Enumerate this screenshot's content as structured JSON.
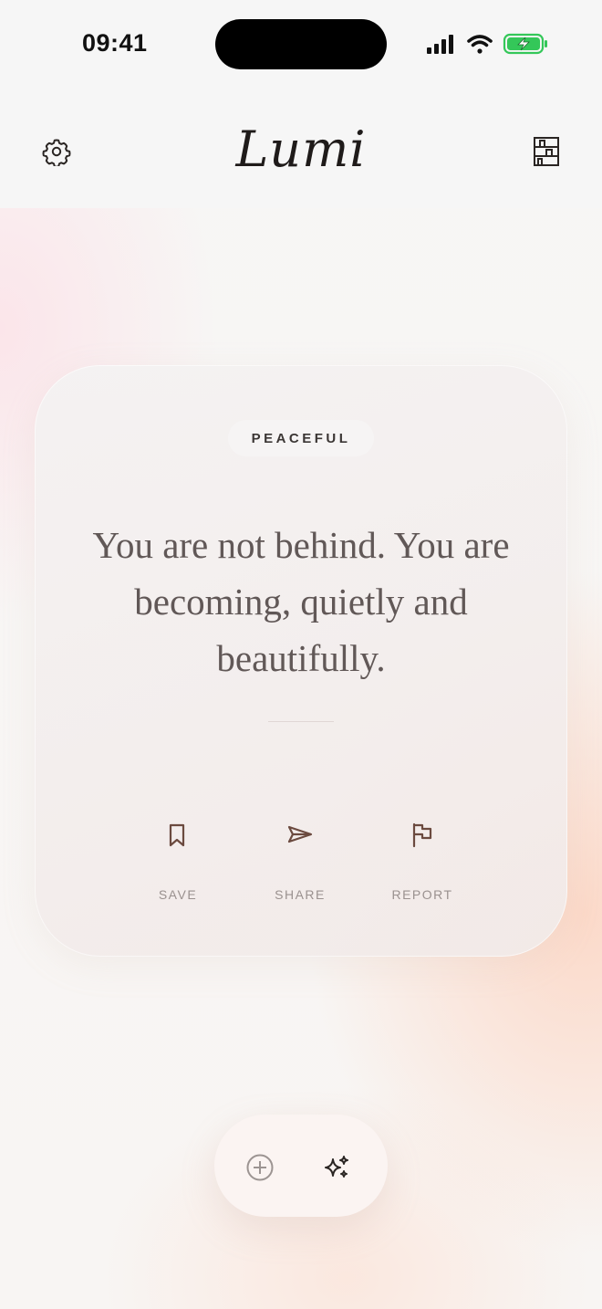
{
  "status_bar": {
    "time": "09:41"
  },
  "header": {
    "app_name": "Lumi",
    "left_icon": "gear-icon",
    "right_icon": "library-icon"
  },
  "card": {
    "mood": "PEACEFUL",
    "quote": "You are not behind. You are becoming, quietly and beautifully.",
    "actions": [
      {
        "label": "SAVE",
        "icon": "bookmark-icon"
      },
      {
        "label": "SHARE",
        "icon": "send-icon"
      },
      {
        "label": "REPORT",
        "icon": "flag-icon"
      }
    ]
  },
  "bottom_bar": {
    "left_icon": "plus-circle-icon",
    "right_icon": "sparkles-icon"
  },
  "colors": {
    "accent": "#6b4a3f",
    "text_primary": "#1f1b1a",
    "quote_text": "#615857",
    "battery_green": "#34c759"
  }
}
